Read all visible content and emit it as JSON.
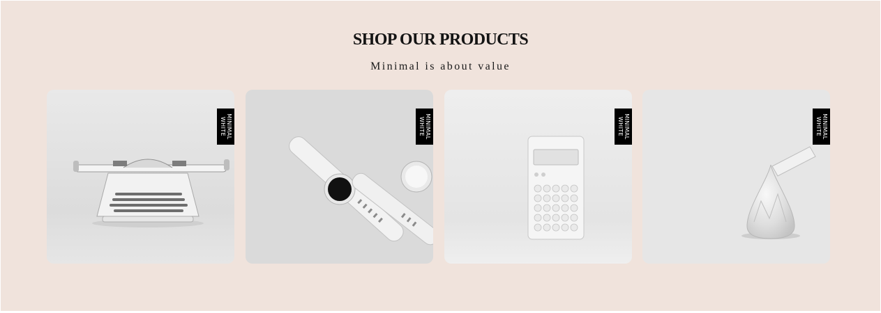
{
  "section": {
    "title": "SHOP OUR PRODUCTS",
    "subtitle": "Minimal is about value"
  },
  "brand_badge": {
    "line1": "MINIMAL",
    "line2": "WHITE"
  },
  "products": [
    {
      "image": "typewriter-image"
    },
    {
      "image": "wristwatches-image"
    },
    {
      "image": "calculator-image"
    },
    {
      "image": "wrapped-chocolate-image"
    }
  ],
  "colors": {
    "background": "#f0e3dc",
    "heading": "#141414",
    "badge": "#000000"
  }
}
